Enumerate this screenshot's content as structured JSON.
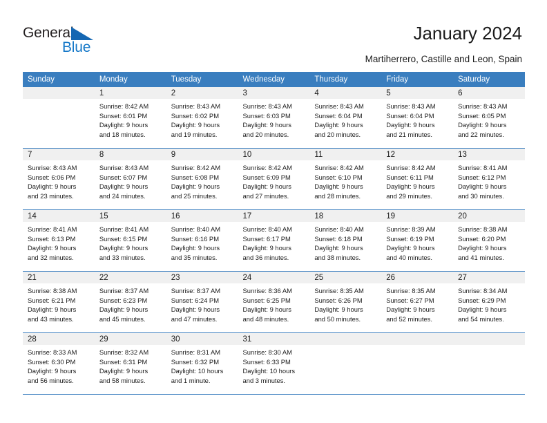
{
  "brand": {
    "name_part1": "General",
    "name_part2": "Blue",
    "triangle_color": "#1567b3",
    "blue_color": "#1578c8"
  },
  "header": {
    "title": "January 2024",
    "subtitle": "Martiherrero, Castille and Leon, Spain"
  },
  "calendar": {
    "header_color": "#3a7ebf",
    "weekdays": [
      "Sunday",
      "Monday",
      "Tuesday",
      "Wednesday",
      "Thursday",
      "Friday",
      "Saturday"
    ],
    "weeks": [
      [
        {
          "day": "",
          "sunrise": "",
          "sunset": "",
          "daylight1": "",
          "daylight2": ""
        },
        {
          "day": "1",
          "sunrise": "Sunrise: 8:42 AM",
          "sunset": "Sunset: 6:01 PM",
          "daylight1": "Daylight: 9 hours",
          "daylight2": "and 18 minutes."
        },
        {
          "day": "2",
          "sunrise": "Sunrise: 8:43 AM",
          "sunset": "Sunset: 6:02 PM",
          "daylight1": "Daylight: 9 hours",
          "daylight2": "and 19 minutes."
        },
        {
          "day": "3",
          "sunrise": "Sunrise: 8:43 AM",
          "sunset": "Sunset: 6:03 PM",
          "daylight1": "Daylight: 9 hours",
          "daylight2": "and 20 minutes."
        },
        {
          "day": "4",
          "sunrise": "Sunrise: 8:43 AM",
          "sunset": "Sunset: 6:04 PM",
          "daylight1": "Daylight: 9 hours",
          "daylight2": "and 20 minutes."
        },
        {
          "day": "5",
          "sunrise": "Sunrise: 8:43 AM",
          "sunset": "Sunset: 6:04 PM",
          "daylight1": "Daylight: 9 hours",
          "daylight2": "and 21 minutes."
        },
        {
          "day": "6",
          "sunrise": "Sunrise: 8:43 AM",
          "sunset": "Sunset: 6:05 PM",
          "daylight1": "Daylight: 9 hours",
          "daylight2": "and 22 minutes."
        }
      ],
      [
        {
          "day": "7",
          "sunrise": "Sunrise: 8:43 AM",
          "sunset": "Sunset: 6:06 PM",
          "daylight1": "Daylight: 9 hours",
          "daylight2": "and 23 minutes."
        },
        {
          "day": "8",
          "sunrise": "Sunrise: 8:43 AM",
          "sunset": "Sunset: 6:07 PM",
          "daylight1": "Daylight: 9 hours",
          "daylight2": "and 24 minutes."
        },
        {
          "day": "9",
          "sunrise": "Sunrise: 8:42 AM",
          "sunset": "Sunset: 6:08 PM",
          "daylight1": "Daylight: 9 hours",
          "daylight2": "and 25 minutes."
        },
        {
          "day": "10",
          "sunrise": "Sunrise: 8:42 AM",
          "sunset": "Sunset: 6:09 PM",
          "daylight1": "Daylight: 9 hours",
          "daylight2": "and 27 minutes."
        },
        {
          "day": "11",
          "sunrise": "Sunrise: 8:42 AM",
          "sunset": "Sunset: 6:10 PM",
          "daylight1": "Daylight: 9 hours",
          "daylight2": "and 28 minutes."
        },
        {
          "day": "12",
          "sunrise": "Sunrise: 8:42 AM",
          "sunset": "Sunset: 6:11 PM",
          "daylight1": "Daylight: 9 hours",
          "daylight2": "and 29 minutes."
        },
        {
          "day": "13",
          "sunrise": "Sunrise: 8:41 AM",
          "sunset": "Sunset: 6:12 PM",
          "daylight1": "Daylight: 9 hours",
          "daylight2": "and 30 minutes."
        }
      ],
      [
        {
          "day": "14",
          "sunrise": "Sunrise: 8:41 AM",
          "sunset": "Sunset: 6:13 PM",
          "daylight1": "Daylight: 9 hours",
          "daylight2": "and 32 minutes."
        },
        {
          "day": "15",
          "sunrise": "Sunrise: 8:41 AM",
          "sunset": "Sunset: 6:15 PM",
          "daylight1": "Daylight: 9 hours",
          "daylight2": "and 33 minutes."
        },
        {
          "day": "16",
          "sunrise": "Sunrise: 8:40 AM",
          "sunset": "Sunset: 6:16 PM",
          "daylight1": "Daylight: 9 hours",
          "daylight2": "and 35 minutes."
        },
        {
          "day": "17",
          "sunrise": "Sunrise: 8:40 AM",
          "sunset": "Sunset: 6:17 PM",
          "daylight1": "Daylight: 9 hours",
          "daylight2": "and 36 minutes."
        },
        {
          "day": "18",
          "sunrise": "Sunrise: 8:40 AM",
          "sunset": "Sunset: 6:18 PM",
          "daylight1": "Daylight: 9 hours",
          "daylight2": "and 38 minutes."
        },
        {
          "day": "19",
          "sunrise": "Sunrise: 8:39 AM",
          "sunset": "Sunset: 6:19 PM",
          "daylight1": "Daylight: 9 hours",
          "daylight2": "and 40 minutes."
        },
        {
          "day": "20",
          "sunrise": "Sunrise: 8:38 AM",
          "sunset": "Sunset: 6:20 PM",
          "daylight1": "Daylight: 9 hours",
          "daylight2": "and 41 minutes."
        }
      ],
      [
        {
          "day": "21",
          "sunrise": "Sunrise: 8:38 AM",
          "sunset": "Sunset: 6:21 PM",
          "daylight1": "Daylight: 9 hours",
          "daylight2": "and 43 minutes."
        },
        {
          "day": "22",
          "sunrise": "Sunrise: 8:37 AM",
          "sunset": "Sunset: 6:23 PM",
          "daylight1": "Daylight: 9 hours",
          "daylight2": "and 45 minutes."
        },
        {
          "day": "23",
          "sunrise": "Sunrise: 8:37 AM",
          "sunset": "Sunset: 6:24 PM",
          "daylight1": "Daylight: 9 hours",
          "daylight2": "and 47 minutes."
        },
        {
          "day": "24",
          "sunrise": "Sunrise: 8:36 AM",
          "sunset": "Sunset: 6:25 PM",
          "daylight1": "Daylight: 9 hours",
          "daylight2": "and 48 minutes."
        },
        {
          "day": "25",
          "sunrise": "Sunrise: 8:35 AM",
          "sunset": "Sunset: 6:26 PM",
          "daylight1": "Daylight: 9 hours",
          "daylight2": "and 50 minutes."
        },
        {
          "day": "26",
          "sunrise": "Sunrise: 8:35 AM",
          "sunset": "Sunset: 6:27 PM",
          "daylight1": "Daylight: 9 hours",
          "daylight2": "and 52 minutes."
        },
        {
          "day": "27",
          "sunrise": "Sunrise: 8:34 AM",
          "sunset": "Sunset: 6:29 PM",
          "daylight1": "Daylight: 9 hours",
          "daylight2": "and 54 minutes."
        }
      ],
      [
        {
          "day": "28",
          "sunrise": "Sunrise: 8:33 AM",
          "sunset": "Sunset: 6:30 PM",
          "daylight1": "Daylight: 9 hours",
          "daylight2": "and 56 minutes."
        },
        {
          "day": "29",
          "sunrise": "Sunrise: 8:32 AM",
          "sunset": "Sunset: 6:31 PM",
          "daylight1": "Daylight: 9 hours",
          "daylight2": "and 58 minutes."
        },
        {
          "day": "30",
          "sunrise": "Sunrise: 8:31 AM",
          "sunset": "Sunset: 6:32 PM",
          "daylight1": "Daylight: 10 hours",
          "daylight2": "and 1 minute."
        },
        {
          "day": "31",
          "sunrise": "Sunrise: 8:30 AM",
          "sunset": "Sunset: 6:33 PM",
          "daylight1": "Daylight: 10 hours",
          "daylight2": "and 3 minutes."
        },
        {
          "day": "",
          "sunrise": "",
          "sunset": "",
          "daylight1": "",
          "daylight2": ""
        },
        {
          "day": "",
          "sunrise": "",
          "sunset": "",
          "daylight1": "",
          "daylight2": ""
        },
        {
          "day": "",
          "sunrise": "",
          "sunset": "",
          "daylight1": "",
          "daylight2": ""
        }
      ]
    ]
  }
}
